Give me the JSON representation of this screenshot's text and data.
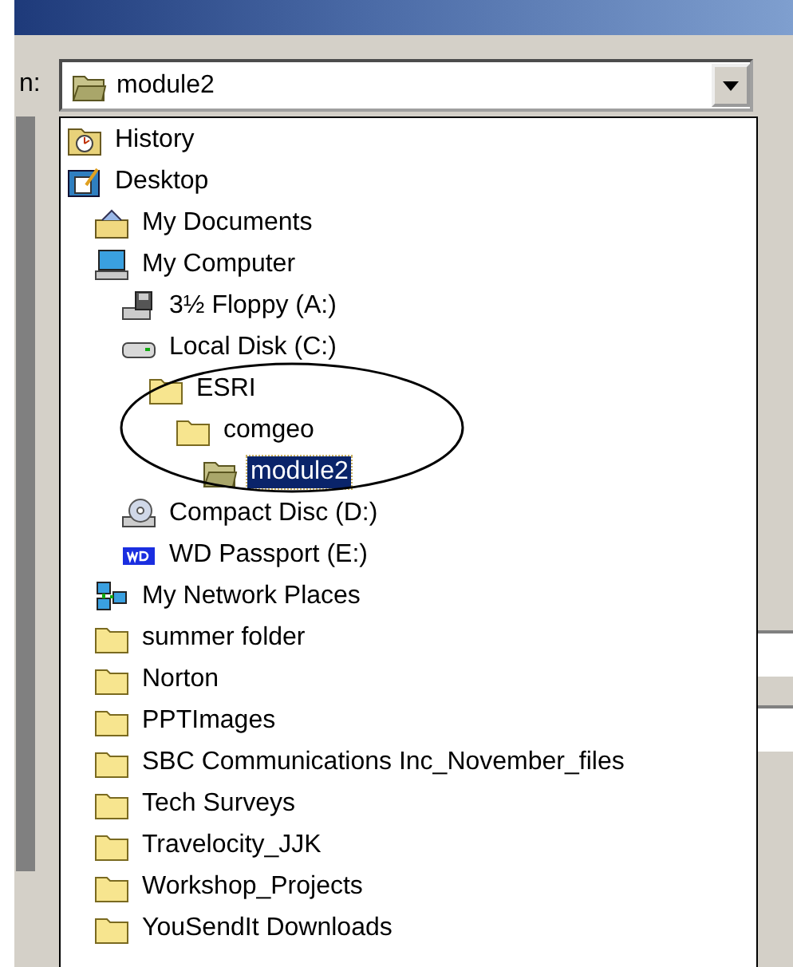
{
  "look_in": {
    "label": "n:",
    "value": "module2",
    "kind": "folder-open"
  },
  "dropdown": {
    "items": [
      {
        "label": "History",
        "kind": "history",
        "selected": false
      },
      {
        "label": "Desktop",
        "kind": "desktop",
        "selected": false,
        "children": [
          {
            "label": "My Documents",
            "kind": "documents",
            "selected": false
          },
          {
            "label": "My Computer",
            "kind": "computer",
            "selected": false,
            "children": [
              {
                "label": "3½ Floppy (A:)",
                "kind": "floppy",
                "selected": false
              },
              {
                "label": "Local Disk (C:)",
                "kind": "disk",
                "selected": false,
                "children": [
                  {
                    "label": "ESRI",
                    "kind": "folder",
                    "selected": false,
                    "children": [
                      {
                        "label": "comgeo",
                        "kind": "folder",
                        "selected": false,
                        "children": [
                          {
                            "label": "module2",
                            "kind": "folder-open",
                            "selected": true
                          }
                        ]
                      }
                    ]
                  }
                ]
              },
              {
                "label": "Compact Disc (D:)",
                "kind": "cdrom",
                "selected": false
              },
              {
                "label": "WD Passport (E:)",
                "kind": "wd",
                "selected": false
              }
            ]
          },
          {
            "label": "My Network Places",
            "kind": "network",
            "selected": false
          },
          {
            "label": "summer folder",
            "kind": "folder",
            "selected": false
          },
          {
            "label": "Norton",
            "kind": "folder",
            "selected": false
          },
          {
            "label": "PPTImages",
            "kind": "folder",
            "selected": false
          },
          {
            "label": "SBC Communications Inc_November_files",
            "kind": "folder",
            "selected": false
          },
          {
            "label": "Tech Surveys",
            "kind": "folder",
            "selected": false
          },
          {
            "label": "Travelocity_JJK",
            "kind": "folder",
            "selected": false
          },
          {
            "label": "Workshop_Projects",
            "kind": "folder",
            "selected": false
          },
          {
            "label": "YouSendIt Downloads",
            "kind": "folder",
            "selected": false
          }
        ]
      }
    ]
  }
}
